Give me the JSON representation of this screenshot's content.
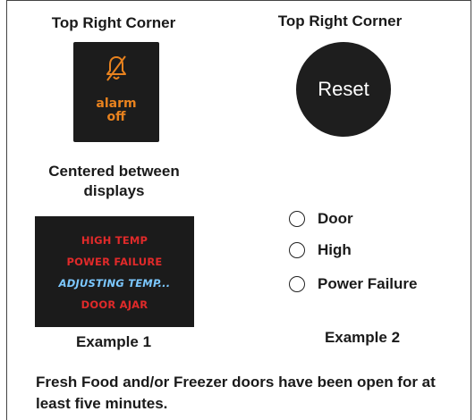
{
  "headings": {
    "left": "Top Right Corner",
    "right": "Top Right Corner",
    "center": "Centered between displays"
  },
  "alarm_button": {
    "icon": "bell-off-icon",
    "line1": "alarm",
    "line2": "off",
    "accent_color": "#e8821e"
  },
  "reset_button": {
    "label": "Reset"
  },
  "display": {
    "messages": [
      {
        "text": "HIGH TEMP",
        "color": "#e02a2a"
      },
      {
        "text": "POWER FAILURE",
        "color": "#e02a2a"
      },
      {
        "text": "ADJUSTING TEMP...",
        "color": "#7cc8ff"
      },
      {
        "text": "DOOR AJAR",
        "color": "#e02a2a"
      }
    ]
  },
  "indicators": [
    {
      "label": "Door"
    },
    {
      "label": "High"
    },
    {
      "label": "Power Failure"
    }
  ],
  "examples": {
    "ex1": "Example 1",
    "ex2": "Example 2"
  },
  "footer": {
    "text": "Fresh Food and/or Freezer doors have been open for at least five minutes."
  }
}
